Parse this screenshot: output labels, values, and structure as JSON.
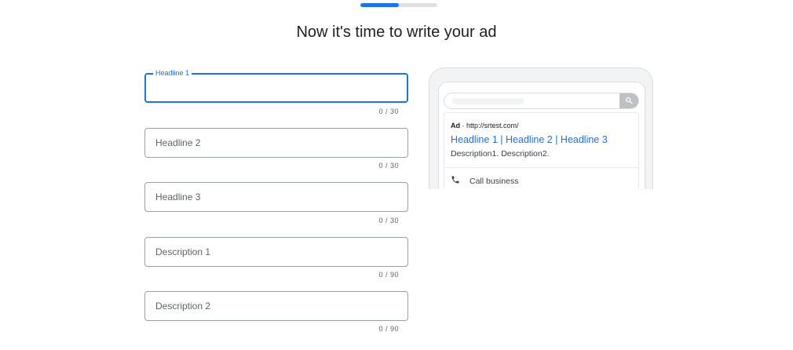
{
  "progress": {
    "fraction": 0.5
  },
  "page_title": "Now it's time to write your ad",
  "fields": [
    {
      "label": "Headline 1",
      "value": "",
      "counter": "0 / 30",
      "focused": true
    },
    {
      "label": "Headline 2",
      "value": "",
      "counter": "0 / 30",
      "focused": false
    },
    {
      "label": "Headline 3",
      "value": "",
      "counter": "0 / 30",
      "focused": false
    },
    {
      "label": "Description 1",
      "value": "",
      "counter": "0 / 90",
      "focused": false
    },
    {
      "label": "Description 2",
      "value": "",
      "counter": "0 / 90",
      "focused": false
    }
  ],
  "preview": {
    "ad_badge": "Ad",
    "separator": " · ",
    "url": "http://srtest.com/",
    "headline": "Headline 1 | Headline 2 | Headline 3",
    "description": "Description1. Description2.",
    "call_label": "Call business",
    "search_icon": "search-icon",
    "call_icon": "phone-icon"
  },
  "colors": {
    "accent": "#1a73e8",
    "border": "#9aa0a6",
    "muted": "#5f6368"
  }
}
